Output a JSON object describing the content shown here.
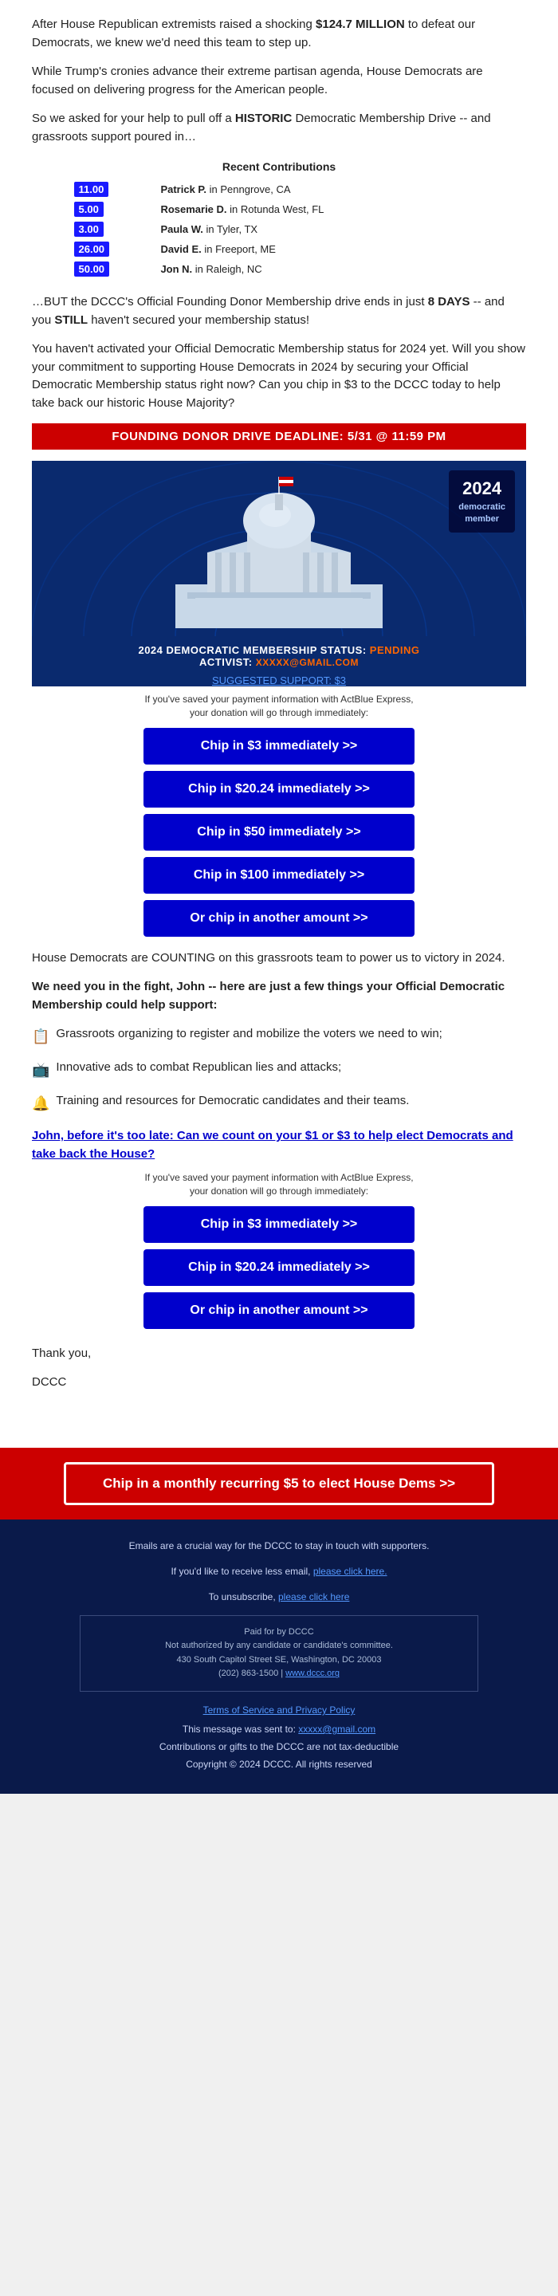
{
  "body_text": {
    "para1": "After House Republican extremists raised a shocking ",
    "para1_bold": "$124.7 MILLION",
    "para1_cont": " to defeat our Democrats, we knew we'd need this team to step up.",
    "para2": "While Trump's cronies advance their extreme partisan agenda, House Democrats are focused on delivering progress for the American people.",
    "para3_pre": "So we asked for your help to pull off a ",
    "para3_bold": "HISTORIC",
    "para3_cont": " Democratic Membership Drive -- and grassroots support poured in…",
    "days_bold": "8 DAYS",
    "still_bold": "STILL",
    "para4": "…BUT the DCCC's Official Founding Donor Membership drive ends in just ",
    "para4_cont": " -- and you ",
    "para4_cont2": " haven't secured your membership status!",
    "para5": "You haven't activated your Official Democratic Membership status for 2024 yet. Will you show your commitment to supporting House Democrats in 2024 by securing your Official Democratic Membership status right now? Can you chip in $3 to the DCCC today to help take back our historic House Majority?"
  },
  "recent_contributions": {
    "title": "Recent Contributions",
    "items": [
      {
        "amount": "11.00",
        "name": "Patrick P.",
        "location": "in Penngrove, CA"
      },
      {
        "amount": "5.00",
        "name": "Rosemarie D.",
        "location": "in Rotunda West, FL"
      },
      {
        "amount": "3.00",
        "name": "Paula W.",
        "location": "in Tyler, TX"
      },
      {
        "amount": "26.00",
        "name": "David E.",
        "location": "in Freeport, ME"
      },
      {
        "amount": "50.00",
        "name": "Jon N.",
        "location": "in Raleigh, NC"
      }
    ]
  },
  "deadline_banner": "FOUNDING DONOR DRIVE DEADLINE: 5/31 @ 11:59 PM",
  "badge": {
    "year": "2024",
    "line1": "democratic",
    "line2": "member"
  },
  "membership": {
    "status_label": "2024 DEMOCRATIC MEMBERSHIP STATUS:",
    "status_value": "PENDING",
    "activist_label": "ACTIVIST:",
    "activist_email": "XXXXX@GMAIL.COM",
    "suggested": "SUGGESTED SUPPORT: $3"
  },
  "actblue_note": "If you've saved your payment information with ActBlue Express,\nyour donation will go through immediately:",
  "buttons_section1": [
    {
      "label": "Chip in $3 immediately >>"
    },
    {
      "label": "Chip in $20.24 immediately >>"
    },
    {
      "label": "Chip in $50 immediately >>"
    },
    {
      "label": "Chip in $100 immediately >>"
    },
    {
      "label": "Or chip in another amount >>"
    }
  ],
  "counting_para": "House Democrats are COUNTING on this grassroots team to power us to victory in 2024.",
  "bold_para": "We need you in the fight, John -- here are just a few things your Official Democratic Membership could help support:",
  "bullet_items": [
    {
      "icon": "📋",
      "text": "Grassroots organizing to register and mobilize the voters we need to win;"
    },
    {
      "icon": "📺",
      "text": "Innovative ads to combat Republican lies and attacks;"
    },
    {
      "icon": "🔔",
      "text": "Training and resources for Democratic candidates and their teams."
    }
  ],
  "cta_link": "John, before it's too late: Can we count on your $1 or $3 to help elect Democrats and take back the House?",
  "actblue_note2": "If you've saved your payment information with ActBlue Express,\nyour donation will go through immediately:",
  "buttons_section2": [
    {
      "label": "Chip in $3 immediately >>"
    },
    {
      "label": "Chip in $20.24 immediately >>"
    },
    {
      "label": "Or chip in another amount >>"
    }
  ],
  "closing": {
    "thanks": "Thank you,",
    "signature": "DCCC"
  },
  "monthly_cta": "Chip in a monthly recurring $5 to elect House Dems >>",
  "footer": {
    "line1": "Emails are a crucial way for the DCCC to stay in touch with supporters.",
    "line2_pre": "If you'd like to receive less email, ",
    "line2_link": "please click here.",
    "line3_pre": "To unsubscribe, ",
    "line3_link": "please click here",
    "legal_box": {
      "line1": "Paid for by DCCC",
      "line2": "Not authorized by any candidate or candidate's committee.",
      "line3": "430 South Capitol Street SE, Washington, DC 20003",
      "line4": "(202) 863-1500 | ",
      "line4_link": "www.dccc.org"
    },
    "terms": "Terms of Service and Privacy Policy",
    "sent_to_pre": "This message was sent to: ",
    "sent_to_email": "xxxxx@gmail.com",
    "tax": "Contributions or gifts to the DCCC are not tax-deductible",
    "copyright": "Copyright © 2024 DCCC. All rights reserved"
  }
}
